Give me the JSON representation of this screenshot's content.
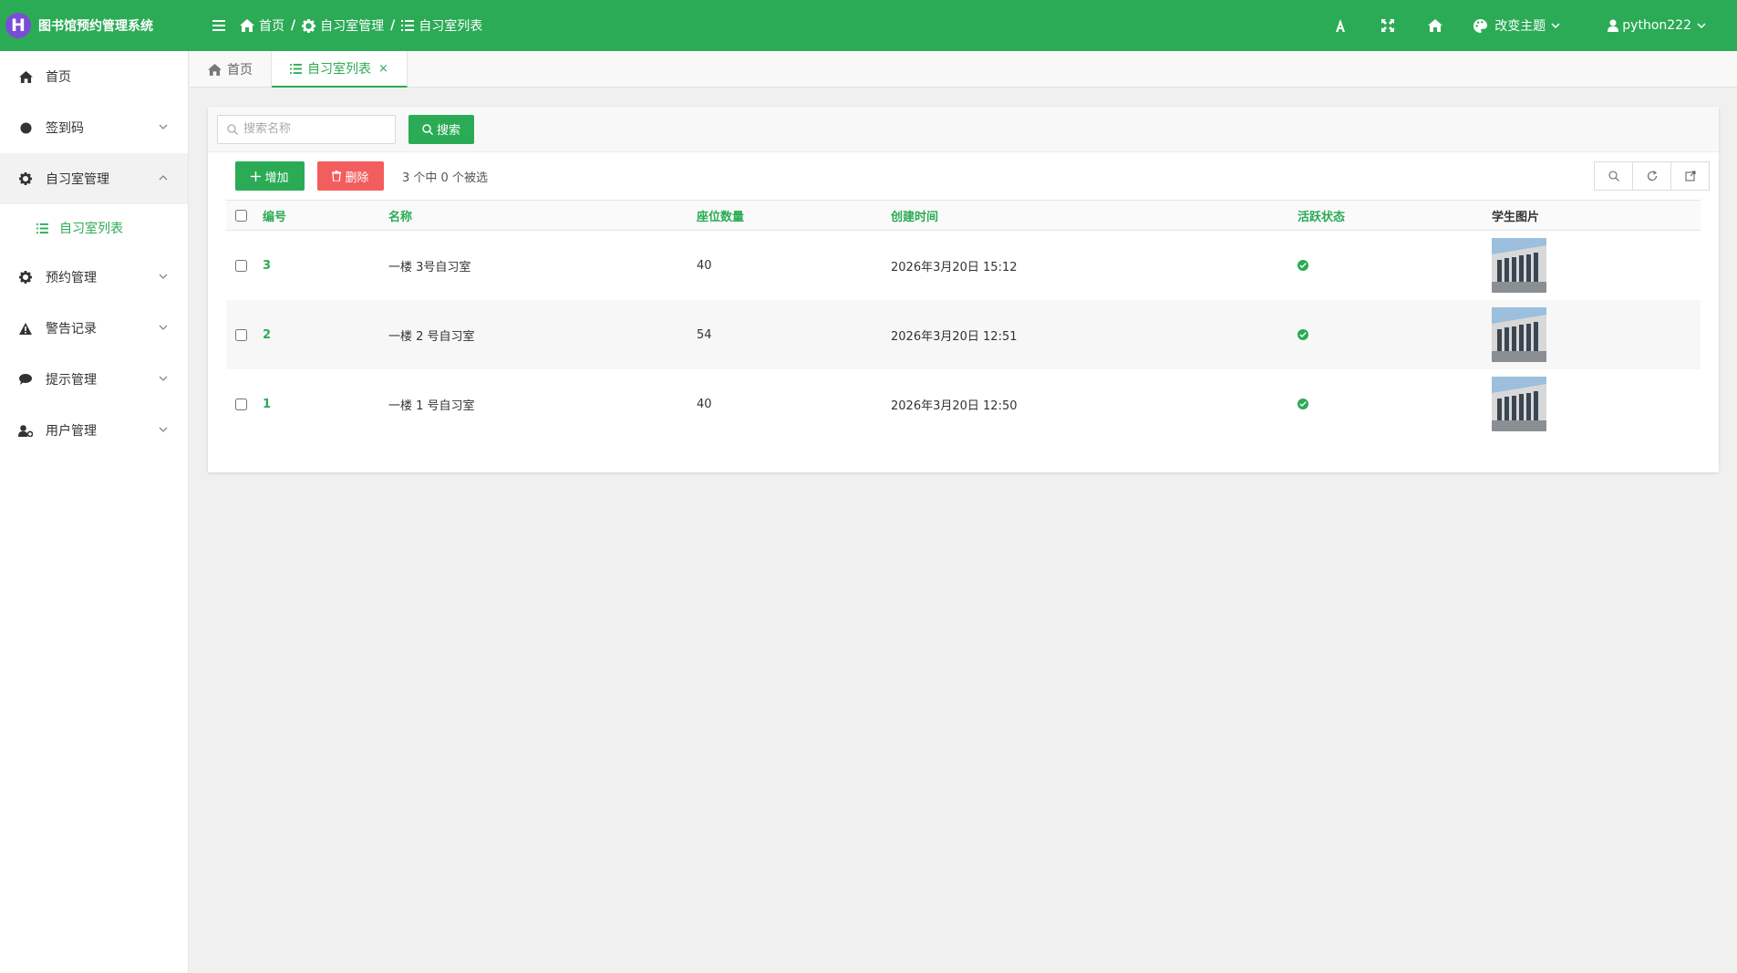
{
  "app": {
    "logo_letter": "H",
    "title": "图书馆预约管理系统"
  },
  "breadcrumb": [
    {
      "label": "首页",
      "icon": "home-icon"
    },
    {
      "label": "自习室管理",
      "icon": "gear-icon"
    },
    {
      "label": "自习室列表",
      "icon": "list-icon"
    }
  ],
  "header": {
    "theme_label": "改变主题",
    "username": "python222"
  },
  "sidebar": {
    "items": [
      {
        "label": "首页",
        "icon": "home-icon"
      },
      {
        "label": "签到码",
        "icon": "circle-icon"
      },
      {
        "label": "自习室管理",
        "icon": "gear-icon",
        "open": true
      },
      {
        "label": "自习室列表",
        "icon": "list-icon",
        "sub": true
      },
      {
        "label": "预约管理",
        "icon": "gear-icon"
      },
      {
        "label": "警告记录",
        "icon": "warning-icon"
      },
      {
        "label": "提示管理",
        "icon": "chat-icon"
      },
      {
        "label": "用户管理",
        "icon": "user-gear-icon"
      }
    ]
  },
  "tabs": [
    {
      "label": "首页",
      "active": false
    },
    {
      "label": "自习室列表",
      "active": true,
      "close": "×"
    }
  ],
  "search": {
    "placeholder": "搜索名称",
    "button_label": "搜索"
  },
  "toolbar": {
    "add_label": "增加",
    "delete_label": "删除",
    "selection_text": "3 个中 0 个被选"
  },
  "table": {
    "columns": [
      "编号",
      "名称",
      "座位数量",
      "创建时间",
      "活跃状态",
      "学生图片"
    ],
    "rows": [
      {
        "id": "3",
        "name": "一楼 3号自习室",
        "seats": "40",
        "created": "2026年3月20日 15:12",
        "active": true
      },
      {
        "id": "2",
        "name": "一楼 2 号自习室",
        "seats": "54",
        "created": "2026年3月20日 12:51",
        "active": true
      },
      {
        "id": "1",
        "name": "一楼 1 号自习室",
        "seats": "40",
        "created": "2026年3月20日 12:50",
        "active": true
      }
    ]
  },
  "colors": {
    "primary": "#2bab55",
    "danger": "#f25d5d",
    "logo_badge": "#7a4dd8"
  }
}
